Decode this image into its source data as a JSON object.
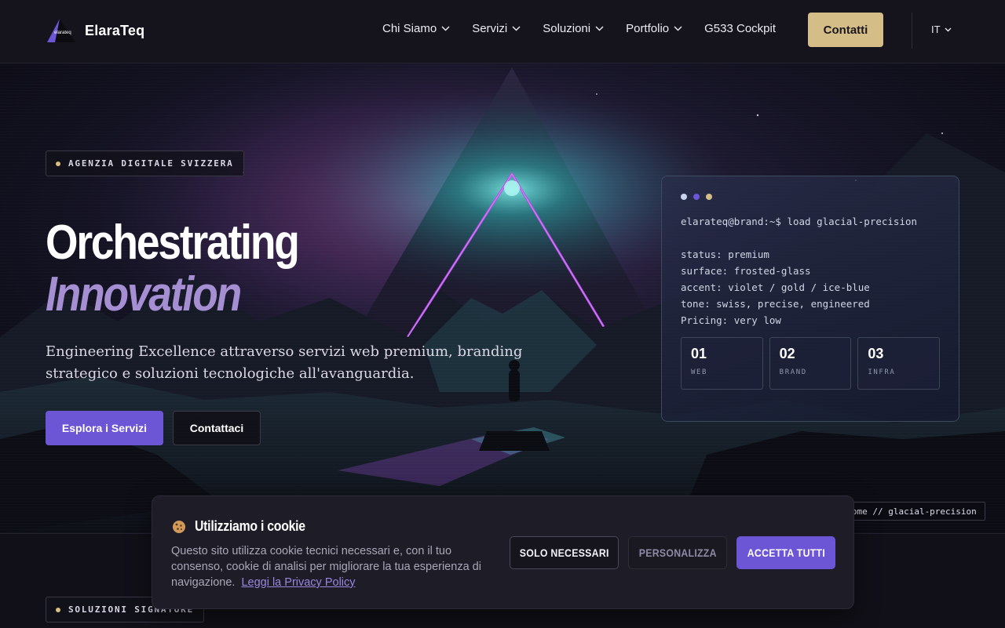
{
  "header": {
    "brand": "ElaraTeq",
    "logo_text": "elarateq",
    "nav": [
      "Chi Siamo",
      "Servizi",
      "Soluzioni",
      "Portfolio",
      "G533 Cockpit"
    ],
    "cta": "Contatti",
    "language": "IT"
  },
  "hero": {
    "badge": "AGENZIA DIGITALE SVIZZERA",
    "title_line1": "Orchestrating",
    "title_line2": "Innovation",
    "subtitle": "Engineering Excellence attraverso servizi web premium, branding strategico e soluzioni tecnologiche all'avanguardia.",
    "primary_button": "Esplora i Servizi",
    "secondary_button": "Contattaci",
    "terminal": {
      "command": "elarateq@brand:~$ load glacial-precision",
      "lines": [
        "status: premium",
        "surface: frosted-glass",
        "accent: violet / gold / ice-blue",
        "tone: swiss, precise, engineered",
        "Pricing: very low"
      ],
      "stats": [
        {
          "num": "01",
          "label": "WEB"
        },
        {
          "num": "02",
          "label": "BRAND"
        },
        {
          "num": "03",
          "label": "INFRA"
        }
      ]
    },
    "path_chip": "elarateq @home // glacial-precision"
  },
  "section": {
    "badge": "SOLUZIONI SIGNATURE"
  },
  "cookie": {
    "title": "Utilizziamo i cookie",
    "text": "Questo sito utilizza cookie tecnici necessari e, con il tuo consenso, cookie di analisi per migliorare la tua esperienza di navigazione.",
    "link": "Leggi la Privacy Policy",
    "btn_necessary": "SOLO NECESSARI",
    "btn_customize": "PERSONALIZZA",
    "btn_accept": "ACCETTA TUTTI"
  },
  "colors": {
    "accent_violet": "#6c56d6",
    "accent_gold": "#d4bd87",
    "title_violet": "#a58fd2",
    "terminal_dots": [
      "#c9d4ec",
      "#6c56d6",
      "#d4bd87"
    ]
  },
  "icons": [
    "elarateq-logo",
    "chevron-down-icon",
    "cookie-icon"
  ]
}
